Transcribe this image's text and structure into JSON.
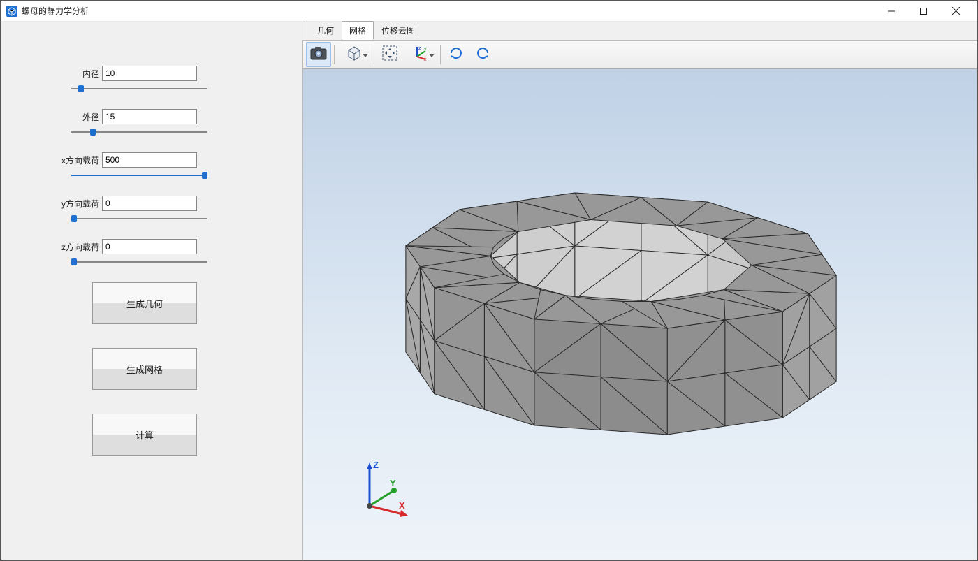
{
  "window": {
    "title": "螺母的静力学分析"
  },
  "sidebar": {
    "params": {
      "inner_radius": {
        "label": "内径",
        "value": "10",
        "slider_pct": 5
      },
      "outer_radius": {
        "label": "外径",
        "value": "15",
        "slider_pct": 14
      },
      "load_x": {
        "label": "x方向载荷",
        "value": "500",
        "slider_pct": 100
      },
      "load_y": {
        "label": "y方向载荷",
        "value": "0",
        "slider_pct": 0
      },
      "load_z": {
        "label": "z方向载荷",
        "value": "0",
        "slider_pct": 0
      }
    },
    "buttons": {
      "generate_geometry": "生成几何",
      "generate_mesh": "生成网格",
      "compute": "计算"
    }
  },
  "tabs": {
    "geometry": "几何",
    "mesh": "网格",
    "displacement": "位移云图",
    "active": "mesh"
  },
  "toolbar_icons": {
    "screenshot": "camera-icon",
    "display_mode": "cube-icon",
    "fit_view": "fit-icon",
    "axes_triad": "axes-icon",
    "rotate_cw": "rotate-cw-icon",
    "rotate_ccw": "rotate-ccw-icon"
  },
  "triad": {
    "x": "X",
    "y": "Y",
    "z": "Z"
  },
  "colors": {
    "accent": "#1f6fd0",
    "axis_x": "#d52b2b",
    "axis_y": "#24a02a",
    "axis_z": "#1e4fd0"
  }
}
